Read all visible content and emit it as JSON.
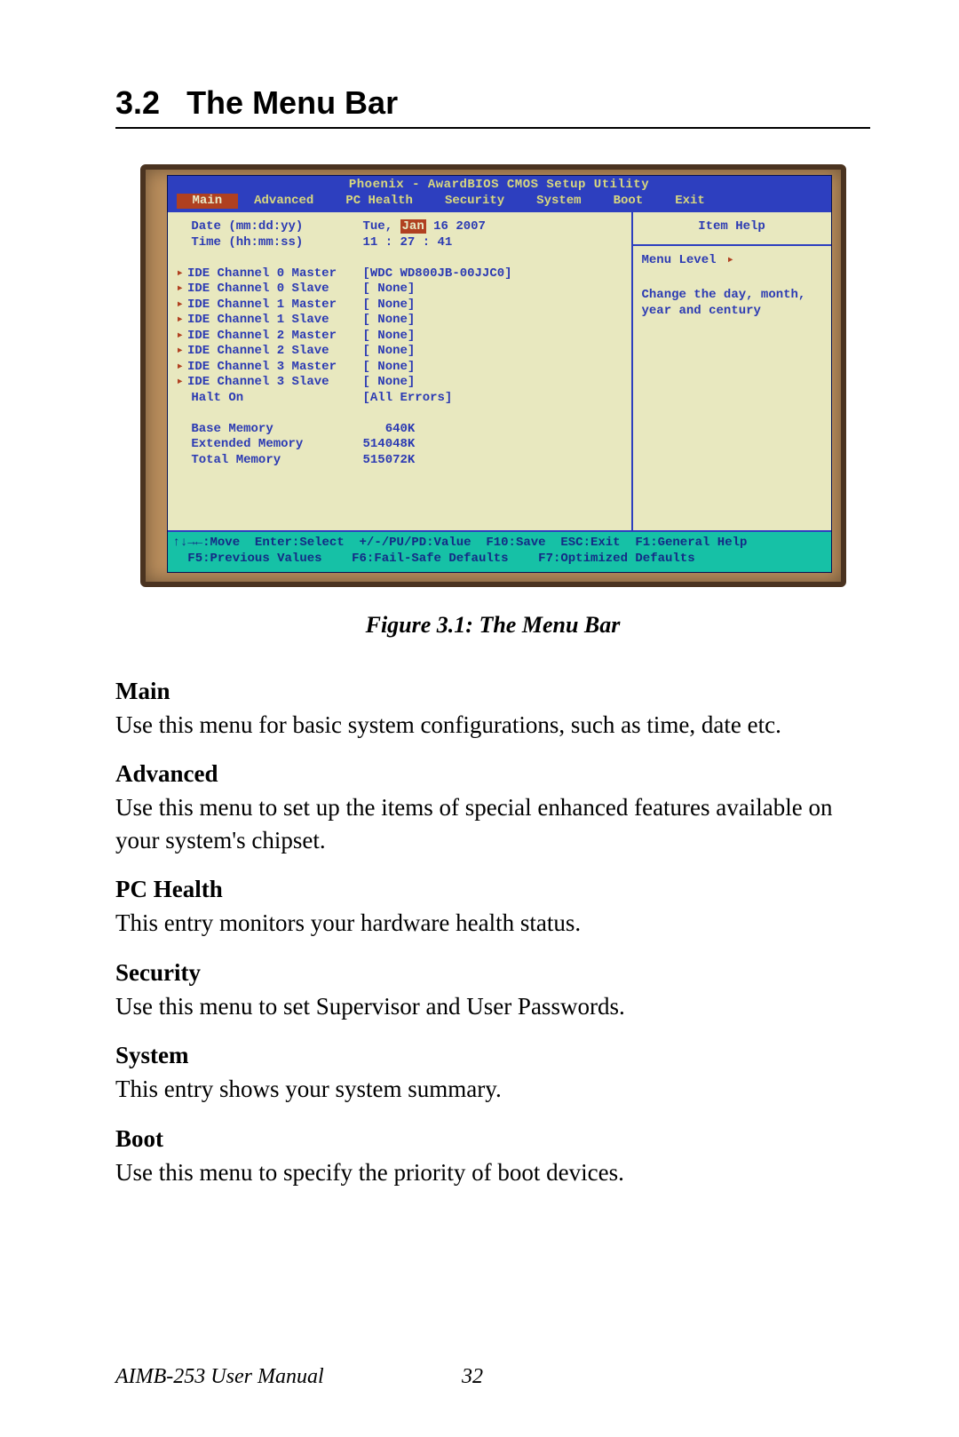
{
  "section": {
    "number": "3.2",
    "title": "The Menu Bar"
  },
  "bios": {
    "title": "Phoenix - AwardBIOS CMOS Setup Utility",
    "tabs": [
      "Main",
      "Advanced",
      "PC Health",
      "Security",
      "System",
      "Boot",
      "Exit"
    ],
    "active_tab_index": 0,
    "date_label": "Date (mm:dd:yy)",
    "date_value_prefix": "Tue, ",
    "date_value_hl": "Jan",
    "date_value_suffix": " 16 2007",
    "time_label": "Time (hh:mm:ss)",
    "time_value": "11 : 27 : 41",
    "channels": [
      {
        "label": "IDE Channel 0 Master",
        "value": "[WDC WD800JB-00JJC0]"
      },
      {
        "label": "IDE Channel 0 Slave",
        "value": "[ None]"
      },
      {
        "label": "IDE Channel 1 Master",
        "value": "[ None]"
      },
      {
        "label": "IDE Channel 1 Slave",
        "value": "[ None]"
      },
      {
        "label": "IDE Channel 2 Master",
        "value": "[ None]"
      },
      {
        "label": "IDE Channel 2 Slave",
        "value": "[ None]"
      },
      {
        "label": "IDE Channel 3 Master",
        "value": "[ None]"
      },
      {
        "label": "IDE Channel 3 Slave",
        "value": "[ None]"
      }
    ],
    "halt_label": "Halt On",
    "halt_value": "[All Errors]",
    "memory": [
      {
        "label": "Base Memory",
        "value": "   640K"
      },
      {
        "label": "Extended Memory",
        "value": "514048K"
      },
      {
        "label": "Total Memory",
        "value": "515072K"
      }
    ],
    "help": {
      "title": "Item Help",
      "menu_level": "Menu Level",
      "text1": "Change the day, month,",
      "text2": "year and century"
    },
    "footer_line1": "↑↓→←:Move  Enter:Select  +/-/PU/PD:Value  F10:Save  ESC:Exit  F1:General Help",
    "footer_line2": "  F5:Previous Values    F6:Fail-Safe Defaults    F7:Optimized Defaults"
  },
  "figure_caption": "Figure 3.1: The Menu Bar",
  "descriptions": [
    {
      "heading": "Main",
      "text": "Use this menu for basic system configurations, such as time, date etc."
    },
    {
      "heading": "Advanced",
      "text": "Use this menu to set up the items of special enhanced features available on your system's chipset."
    },
    {
      "heading": "PC Health",
      "text": "This entry monitors your hardware health status."
    },
    {
      "heading": "Security",
      "text": "Use this menu to set Supervisor and User Passwords."
    },
    {
      "heading": "System",
      "text": "This entry shows your system summary."
    },
    {
      "heading": "Boot",
      "text": "Use this menu to specify the priority of boot devices."
    }
  ],
  "footer": {
    "doc": "AIMB-253 User Manual",
    "page": "32"
  }
}
